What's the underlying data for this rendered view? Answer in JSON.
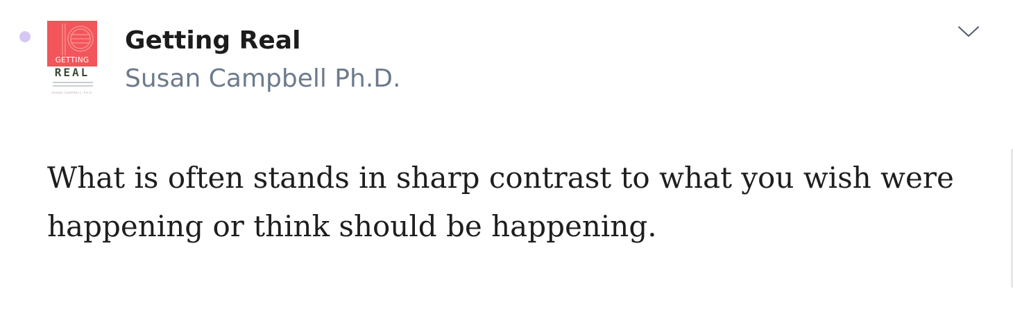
{
  "highlight": {
    "book_title": "Getting Real",
    "author": "Susan Campbell Ph.D.",
    "quote": "What is often stands in sharp contrast to what you wish were happening or think should be happening."
  },
  "cover": {
    "getting": "GETTING",
    "real": "REAL",
    "author_small": "SUSAN CAMPBELL, PH.D."
  },
  "icons": {
    "status_dot": "unread-dot-icon",
    "expand": "chevron-down-icon"
  },
  "colors": {
    "dot": "#d6c7f2",
    "cover_red": "#f2555a",
    "title": "#1c1c1c",
    "author": "#6c7a8c",
    "quote": "#1e1e1e"
  }
}
